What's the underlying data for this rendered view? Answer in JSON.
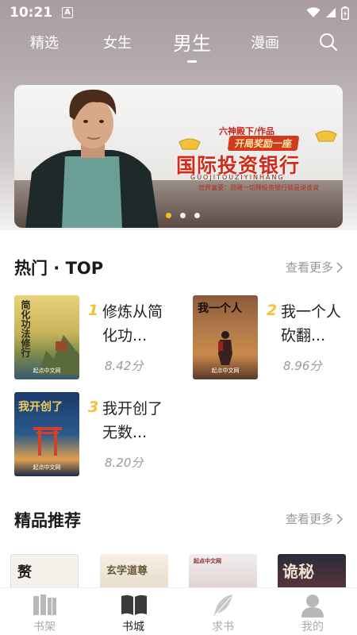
{
  "status": {
    "time": "10:21",
    "notif_letter": "A"
  },
  "nav": {
    "tabs": [
      {
        "label": "精选"
      },
      {
        "label": "女生"
      },
      {
        "label": "男生"
      },
      {
        "label": "漫画"
      }
    ],
    "active": "男生"
  },
  "banner": {
    "author_tag": "六神殿下/作品",
    "slogan": "开局奖励一座",
    "title": "国际投资银行",
    "pinyin": "GUOJITOUZIYINHANG",
    "blurb": "世界富豪：目睹一切拜投资银行就是说谁说",
    "slide_count": 3,
    "active_slide": 0
  },
  "hot": {
    "title": "热门 · TOP",
    "more": "查看更多",
    "books": [
      {
        "rank": "1",
        "title": "修炼从简化功...",
        "score": "8.42分",
        "cover_text": "简化功法修行",
        "cover_foot": "起点中文网"
      },
      {
        "rank": "2",
        "title": "我一个人砍翻...",
        "score": "8.96分",
        "cover_text": "我一个人",
        "cover_foot": "起点中文网"
      },
      {
        "rank": "3",
        "title": "我开创了无数...",
        "score": "8.20分",
        "cover_text": "我开创了",
        "cover_foot": "起点中文网"
      }
    ]
  },
  "featured": {
    "title": "精品推荐",
    "more": "查看更多",
    "covers": [
      {
        "text": "赘"
      },
      {
        "text": "玄学道尊"
      },
      {
        "text": "起点中文网"
      },
      {
        "text": "诡秘"
      }
    ]
  },
  "tabbar": {
    "items": [
      {
        "label": "书架",
        "icon": "bookshelf-icon"
      },
      {
        "label": "书城",
        "icon": "open-book-icon"
      },
      {
        "label": "求书",
        "icon": "feather-icon"
      },
      {
        "label": "我的",
        "icon": "person-icon"
      }
    ],
    "active": "书城"
  }
}
